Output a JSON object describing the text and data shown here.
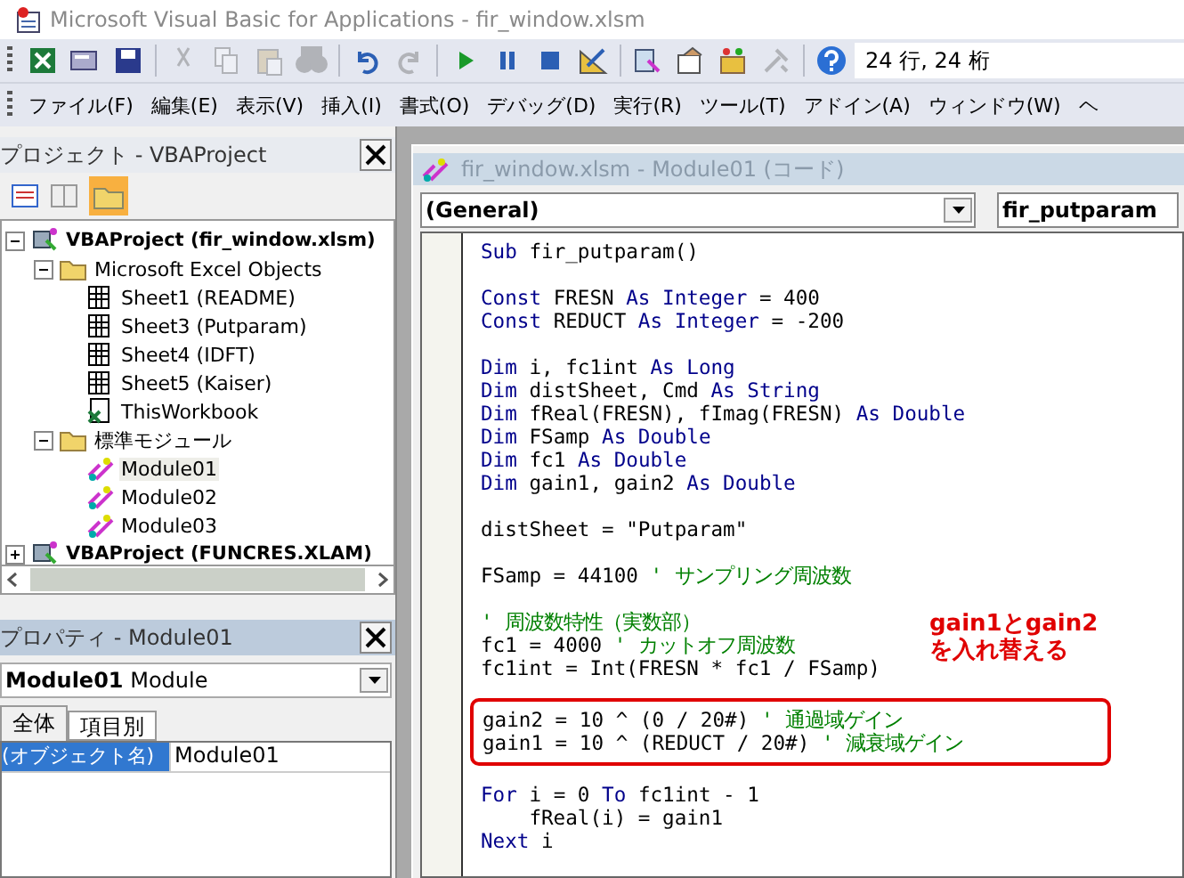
{
  "window": {
    "title": "Microsoft Visual Basic for Applications - fir_window.xlsm"
  },
  "toolbar": {
    "buttons": [
      {
        "kind": "excel",
        "disabled": false
      },
      {
        "kind": "insert-form",
        "disabled": false
      },
      {
        "kind": "save",
        "disabled": false
      },
      {
        "kind": "sep"
      },
      {
        "kind": "cut",
        "disabled": true
      },
      {
        "kind": "copy",
        "disabled": true
      },
      {
        "kind": "paste",
        "disabled": true
      },
      {
        "kind": "find",
        "disabled": true
      },
      {
        "kind": "sep"
      },
      {
        "kind": "undo",
        "disabled": false
      },
      {
        "kind": "redo",
        "disabled": true
      },
      {
        "kind": "sep"
      },
      {
        "kind": "run",
        "disabled": false
      },
      {
        "kind": "pause",
        "disabled": false
      },
      {
        "kind": "stop",
        "disabled": false
      },
      {
        "kind": "design",
        "disabled": false
      },
      {
        "kind": "sep"
      },
      {
        "kind": "project",
        "disabled": false
      },
      {
        "kind": "properties",
        "disabled": false
      },
      {
        "kind": "object-browser",
        "disabled": false
      },
      {
        "kind": "toolbox",
        "disabled": true
      },
      {
        "kind": "sep"
      },
      {
        "kind": "help",
        "disabled": false
      }
    ],
    "position": "24 行, 24 桁"
  },
  "menu": [
    "ファイル(F)",
    "編集(E)",
    "表示(V)",
    "挿入(I)",
    "書式(O)",
    "デバッグ(D)",
    "実行(R)",
    "ツール(T)",
    "アドイン(A)",
    "ウィンドウ(W)",
    "ヘ"
  ],
  "project_pane": {
    "title": "プロジェクト - VBAProject",
    "tree": [
      {
        "kind": "project",
        "label": "VBAProject (fir_window.xlsm)",
        "expanded": true,
        "selected": false,
        "children": [
          {
            "kind": "folder",
            "label": "Microsoft Excel Objects",
            "expanded": true,
            "selected": false,
            "children": [
              {
                "kind": "sheet",
                "label": "Sheet1 (README)",
                "selected": false
              },
              {
                "kind": "sheet",
                "label": "Sheet3 (Putparam)",
                "selected": false
              },
              {
                "kind": "sheet",
                "label": "Sheet4 (IDFT)",
                "selected": false
              },
              {
                "kind": "sheet",
                "label": "Sheet5 (Kaiser)",
                "selected": false
              },
              {
                "kind": "workbook",
                "label": "ThisWorkbook",
                "selected": false
              }
            ]
          },
          {
            "kind": "folder",
            "label": "標準モジュール",
            "expanded": true,
            "selected": false,
            "children": [
              {
                "kind": "module",
                "label": "Module01",
                "selected": true
              },
              {
                "kind": "module",
                "label": "Module02",
                "selected": false
              },
              {
                "kind": "module",
                "label": "Module03",
                "selected": false
              }
            ]
          }
        ]
      },
      {
        "kind": "project",
        "label": "VBAProject (FUNCRES.XLAM)",
        "expanded": false,
        "selected": false
      }
    ]
  },
  "properties_pane": {
    "title": "プロパティ - Module01",
    "object_name": "Module01",
    "object_type": "Module",
    "tabs": [
      {
        "label": "全体",
        "selected": true
      },
      {
        "label": "項目別",
        "selected": false
      }
    ],
    "rows": [
      {
        "name": "(オブジェクト名)",
        "value": "Module01",
        "selected": true
      }
    ]
  },
  "code_window": {
    "title": "fir_window.xlsm - Module01 (コード)",
    "object_combo": "(General)",
    "procedure_combo": "fir_putparam",
    "blocks": [
      {
        "kind": "plain",
        "paragraphs": [
          [
            [
              {
                "kind": "keyword",
                "text": "Sub "
              },
              {
                "kind": "plain",
                "text": "fir_putparam()"
              }
            ]
          ],
          [
            [
              {
                "kind": "keyword",
                "text": "Const "
              },
              {
                "kind": "plain",
                "text": "FRESN "
              },
              {
                "kind": "keyword",
                "text": "As Integer"
              },
              {
                "kind": "plain",
                "text": " = 400"
              }
            ],
            [
              {
                "kind": "keyword",
                "text": "Const "
              },
              {
                "kind": "plain",
                "text": "REDUCT "
              },
              {
                "kind": "keyword",
                "text": "As Integer"
              },
              {
                "kind": "plain",
                "text": " = -200"
              }
            ]
          ],
          [
            [
              {
                "kind": "keyword",
                "text": "Dim "
              },
              {
                "kind": "plain",
                "text": "i, fc1int "
              },
              {
                "kind": "keyword",
                "text": "As Long"
              }
            ],
            [
              {
                "kind": "keyword",
                "text": "Dim "
              },
              {
                "kind": "plain",
                "text": "distSheet, Cmd "
              },
              {
                "kind": "keyword",
                "text": "As String"
              }
            ],
            [
              {
                "kind": "keyword",
                "text": "Dim "
              },
              {
                "kind": "plain",
                "text": "fReal(FRESN), fImag(FRESN) "
              },
              {
                "kind": "keyword",
                "text": "As Double"
              }
            ],
            [
              {
                "kind": "keyword",
                "text": "Dim "
              },
              {
                "kind": "plain",
                "text": "FSamp "
              },
              {
                "kind": "keyword",
                "text": "As Double"
              }
            ],
            [
              {
                "kind": "keyword",
                "text": "Dim "
              },
              {
                "kind": "plain",
                "text": "fc1 "
              },
              {
                "kind": "keyword",
                "text": "As Double"
              }
            ],
            [
              {
                "kind": "keyword",
                "text": "Dim "
              },
              {
                "kind": "plain",
                "text": "gain1, gain2 "
              },
              {
                "kind": "keyword",
                "text": "As Double"
              }
            ]
          ],
          [
            [
              {
                "kind": "plain",
                "text": "distSheet = \"Putparam\""
              }
            ]
          ],
          [
            [
              {
                "kind": "plain",
                "text": "FSamp = 44100 "
              },
              {
                "kind": "comment",
                "text": "' サンプリング周波数"
              }
            ]
          ],
          [
            [
              {
                "kind": "comment",
                "text": "' 周波数特性（実数部）"
              }
            ],
            [
              {
                "kind": "plain",
                "text": "fc1 = 4000 "
              },
              {
                "kind": "comment",
                "text": "' カットオフ周波数"
              }
            ],
            [
              {
                "kind": "plain",
                "text": "fc1int = Int(FRESN * fc1 / FSamp)"
              }
            ]
          ]
        ]
      },
      {
        "kind": "boxed",
        "paragraphs": [
          [
            [
              {
                "kind": "plain",
                "text": "gain2 = 10 ^ (0 / 20#) "
              },
              {
                "kind": "comment",
                "text": "' 通過域ゲイン"
              }
            ],
            [
              {
                "kind": "plain",
                "text": "gain1 = 10 ^ (REDUCT / 20#) "
              },
              {
                "kind": "comment",
                "text": "' 減衰域ゲイン"
              }
            ]
          ]
        ]
      },
      {
        "kind": "plain",
        "paragraphs": [
          [
            [
              {
                "kind": "keyword",
                "text": "For "
              },
              {
                "kind": "plain",
                "text": "i = 0 "
              },
              {
                "kind": "keyword",
                "text": "To "
              },
              {
                "kind": "plain",
                "text": "fc1int - 1"
              }
            ],
            [
              {
                "kind": "plain",
                "text": "    fReal(i) = gain1"
              }
            ],
            [
              {
                "kind": "keyword",
                "text": "Next "
              },
              {
                "kind": "plain",
                "text": "i"
              }
            ]
          ]
        ]
      }
    ],
    "annotation": [
      "gain1とgain2",
      "を入れ替える"
    ]
  }
}
